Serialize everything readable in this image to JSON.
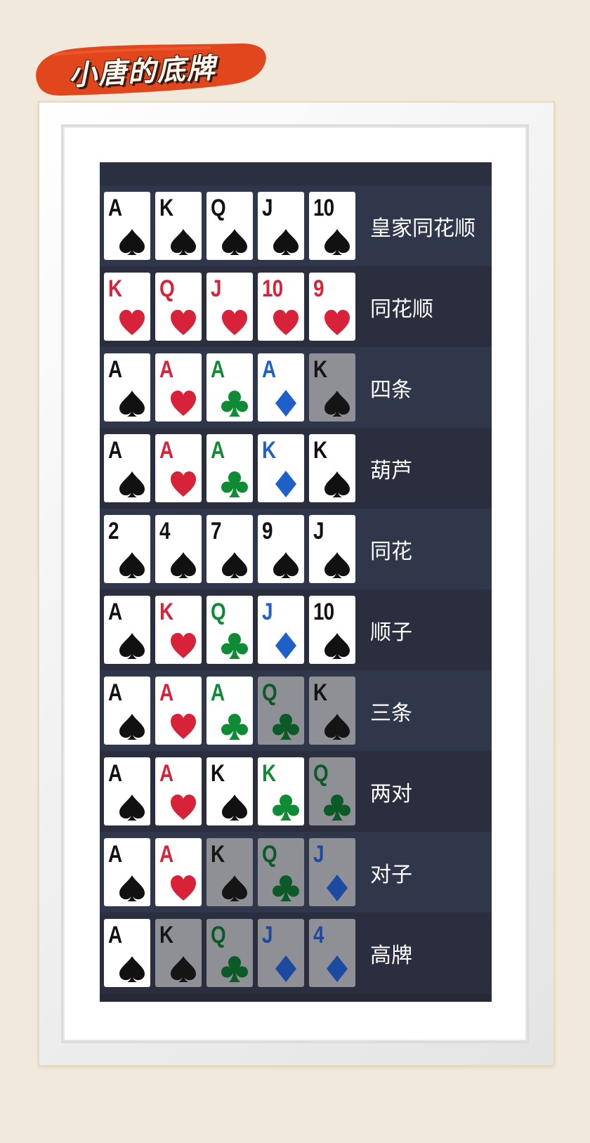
{
  "title": "小唐的底牌",
  "colors": {
    "background": "#f1eadc",
    "banner": "#e2461c",
    "table": "#262a37",
    "spade": "#111111",
    "heart": "#d7223a",
    "club": "#0f8a35",
    "diamond": "#1f5fc9"
  },
  "hands": [
    {
      "name": "皇家同花顺",
      "cards": [
        {
          "rank": "A",
          "suit": "spade",
          "dim": false
        },
        {
          "rank": "K",
          "suit": "spade",
          "dim": false
        },
        {
          "rank": "Q",
          "suit": "spade",
          "dim": false
        },
        {
          "rank": "J",
          "suit": "spade",
          "dim": false
        },
        {
          "rank": "10",
          "suit": "spade",
          "dim": false
        }
      ]
    },
    {
      "name": "同花顺",
      "cards": [
        {
          "rank": "K",
          "suit": "heart",
          "dim": false
        },
        {
          "rank": "Q",
          "suit": "heart",
          "dim": false
        },
        {
          "rank": "J",
          "suit": "heart",
          "dim": false
        },
        {
          "rank": "10",
          "suit": "heart",
          "dim": false
        },
        {
          "rank": "9",
          "suit": "heart",
          "dim": false
        }
      ]
    },
    {
      "name": "四条",
      "cards": [
        {
          "rank": "A",
          "suit": "spade",
          "dim": false
        },
        {
          "rank": "A",
          "suit": "heart",
          "dim": false
        },
        {
          "rank": "A",
          "suit": "club",
          "dim": false
        },
        {
          "rank": "A",
          "suit": "diamond",
          "dim": false
        },
        {
          "rank": "K",
          "suit": "spade",
          "dim": true
        }
      ]
    },
    {
      "name": "葫芦",
      "cards": [
        {
          "rank": "A",
          "suit": "spade",
          "dim": false
        },
        {
          "rank": "A",
          "suit": "heart",
          "dim": false
        },
        {
          "rank": "A",
          "suit": "club",
          "dim": false
        },
        {
          "rank": "K",
          "suit": "diamond",
          "dim": false
        },
        {
          "rank": "K",
          "suit": "spade",
          "dim": false
        }
      ]
    },
    {
      "name": "同花",
      "cards": [
        {
          "rank": "2",
          "suit": "spade",
          "dim": false
        },
        {
          "rank": "4",
          "suit": "spade",
          "dim": false
        },
        {
          "rank": "7",
          "suit": "spade",
          "dim": false
        },
        {
          "rank": "9",
          "suit": "spade",
          "dim": false
        },
        {
          "rank": "J",
          "suit": "spade",
          "dim": false
        }
      ]
    },
    {
      "name": "顺子",
      "cards": [
        {
          "rank": "A",
          "suit": "spade",
          "dim": false
        },
        {
          "rank": "K",
          "suit": "heart",
          "dim": false
        },
        {
          "rank": "Q",
          "suit": "club",
          "dim": false
        },
        {
          "rank": "J",
          "suit": "diamond",
          "dim": false
        },
        {
          "rank": "10",
          "suit": "spade",
          "dim": false
        }
      ]
    },
    {
      "name": "三条",
      "cards": [
        {
          "rank": "A",
          "suit": "spade",
          "dim": false
        },
        {
          "rank": "A",
          "suit": "heart",
          "dim": false
        },
        {
          "rank": "A",
          "suit": "club",
          "dim": false
        },
        {
          "rank": "Q",
          "suit": "club",
          "dim": true
        },
        {
          "rank": "K",
          "suit": "spade",
          "dim": true
        }
      ]
    },
    {
      "name": "两对",
      "cards": [
        {
          "rank": "A",
          "suit": "spade",
          "dim": false
        },
        {
          "rank": "A",
          "suit": "heart",
          "dim": false
        },
        {
          "rank": "K",
          "suit": "spade",
          "dim": false
        },
        {
          "rank": "K",
          "suit": "club",
          "dim": false
        },
        {
          "rank": "Q",
          "suit": "club",
          "dim": true
        }
      ]
    },
    {
      "name": "对子",
      "cards": [
        {
          "rank": "A",
          "suit": "spade",
          "dim": false
        },
        {
          "rank": "A",
          "suit": "heart",
          "dim": false
        },
        {
          "rank": "K",
          "suit": "spade",
          "dim": true
        },
        {
          "rank": "Q",
          "suit": "club",
          "dim": true
        },
        {
          "rank": "J",
          "suit": "diamond",
          "dim": true
        }
      ]
    },
    {
      "name": "高牌",
      "cards": [
        {
          "rank": "A",
          "suit": "spade",
          "dim": false
        },
        {
          "rank": "K",
          "suit": "spade",
          "dim": true
        },
        {
          "rank": "Q",
          "suit": "club",
          "dim": true
        },
        {
          "rank": "J",
          "suit": "diamond",
          "dim": true
        },
        {
          "rank": "4",
          "suit": "diamond",
          "dim": true
        }
      ]
    }
  ]
}
